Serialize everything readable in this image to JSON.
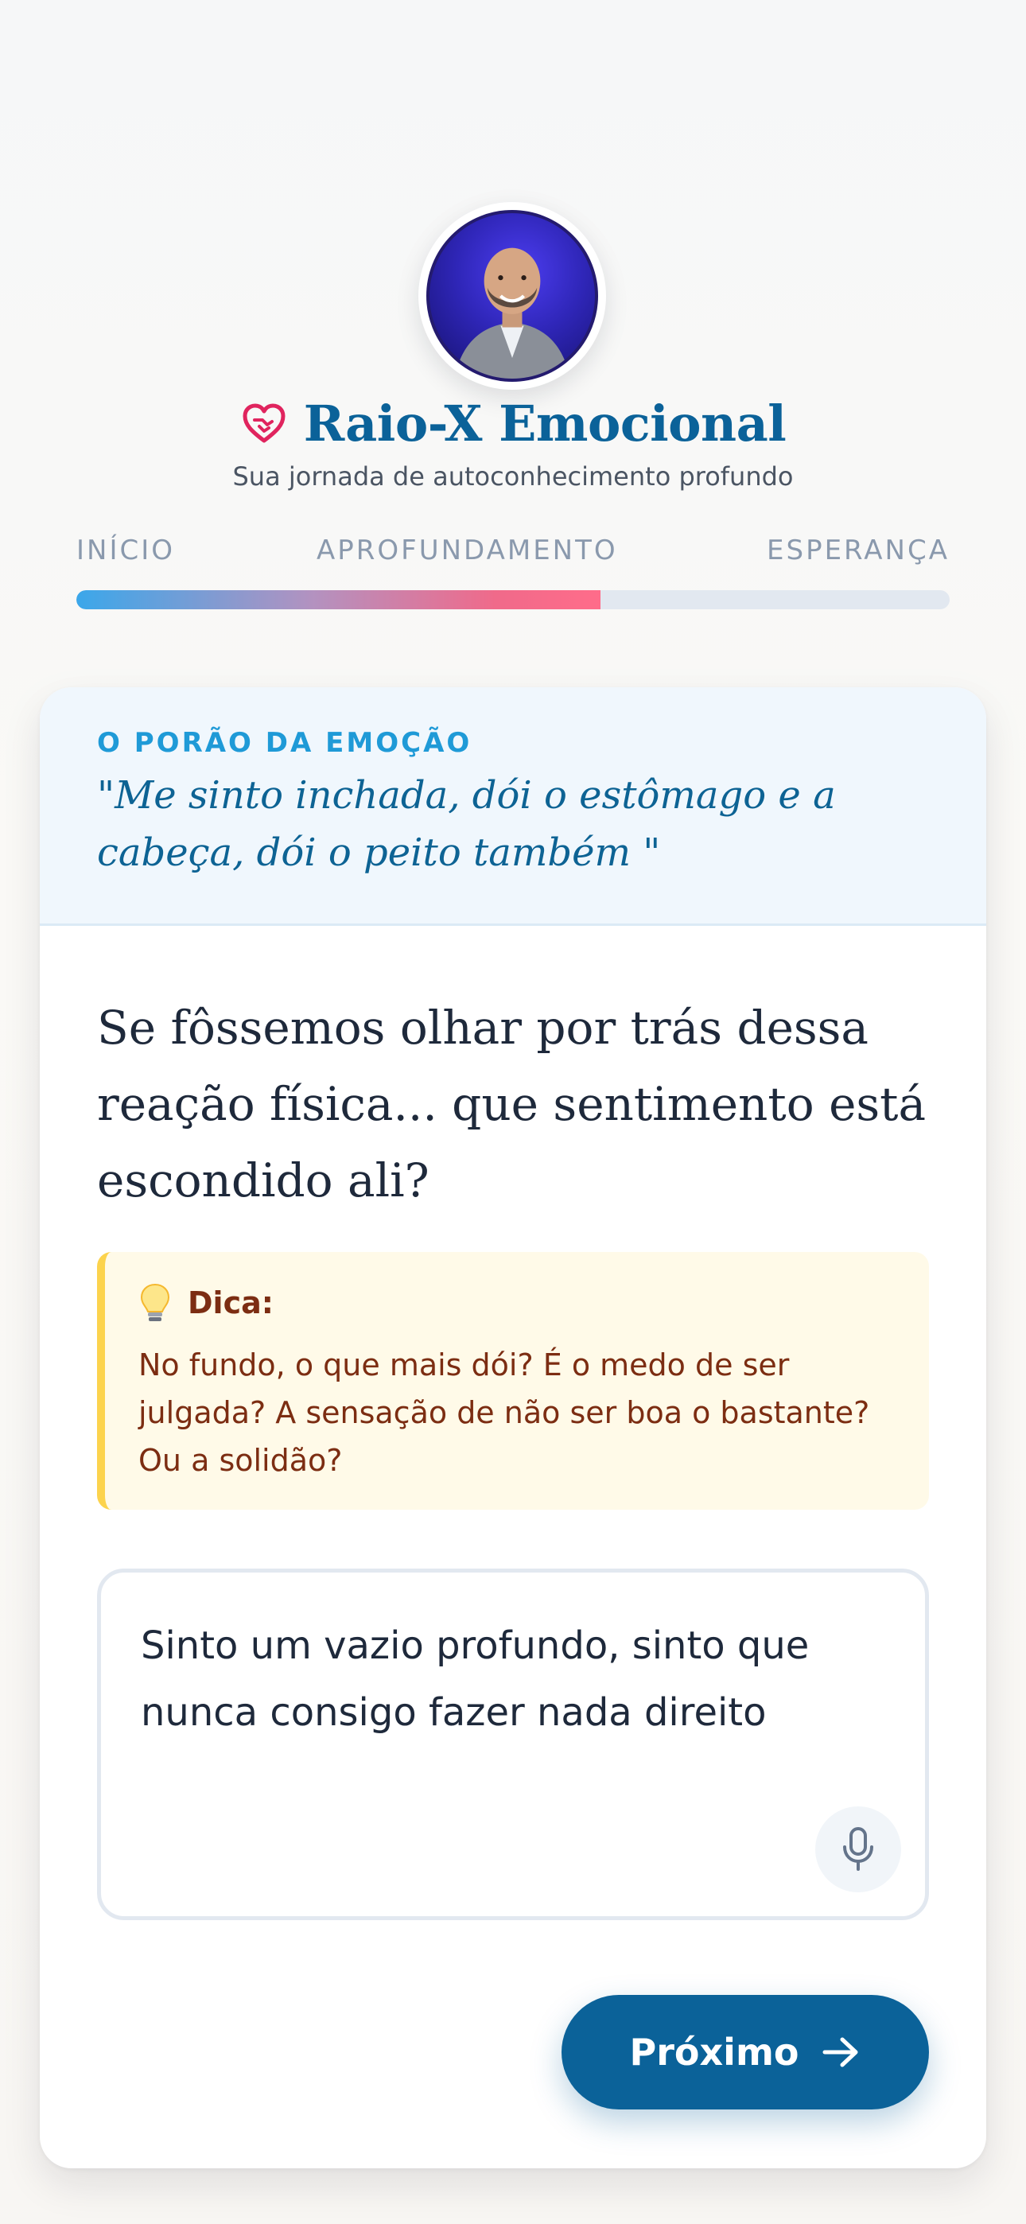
{
  "header": {
    "avatar_icon": "person-photo",
    "heart_icon": "heart-hands-icon",
    "title": "Raio-X Emocional",
    "subtitle": "Sua jornada de autoconhecimento profundo",
    "accent_color": "#0b6299",
    "heart_color": "#e0245e"
  },
  "progress": {
    "steps": [
      "INÍCIO",
      "APROFUNDAMENTO",
      "ESPERANÇA"
    ],
    "current_step": 2,
    "fraction": 0.6
  },
  "card": {
    "section_label": "O PORÃO DA EMOÇÃO",
    "quote": "\"Me sinto inchada, dói o estômago e a cabeça, dói o peito também \"",
    "question": "Se fôssemos olhar por trás dessa reação física... que sentimento está escondido ali?",
    "tip": {
      "icon": "lightbulb-icon",
      "title": "Dica:",
      "text": "No fundo, o que mais dói? É o medo de ser julgada? A sensação de não ser boa o bastante? Ou a solidão?"
    },
    "answer": {
      "value": "Sinto um vazio profundo, sinto que nunca consigo fazer nada direito",
      "mic_icon": "microphone-icon"
    },
    "next_button": {
      "label": "Próximo",
      "icon": "arrow-right-icon"
    }
  }
}
